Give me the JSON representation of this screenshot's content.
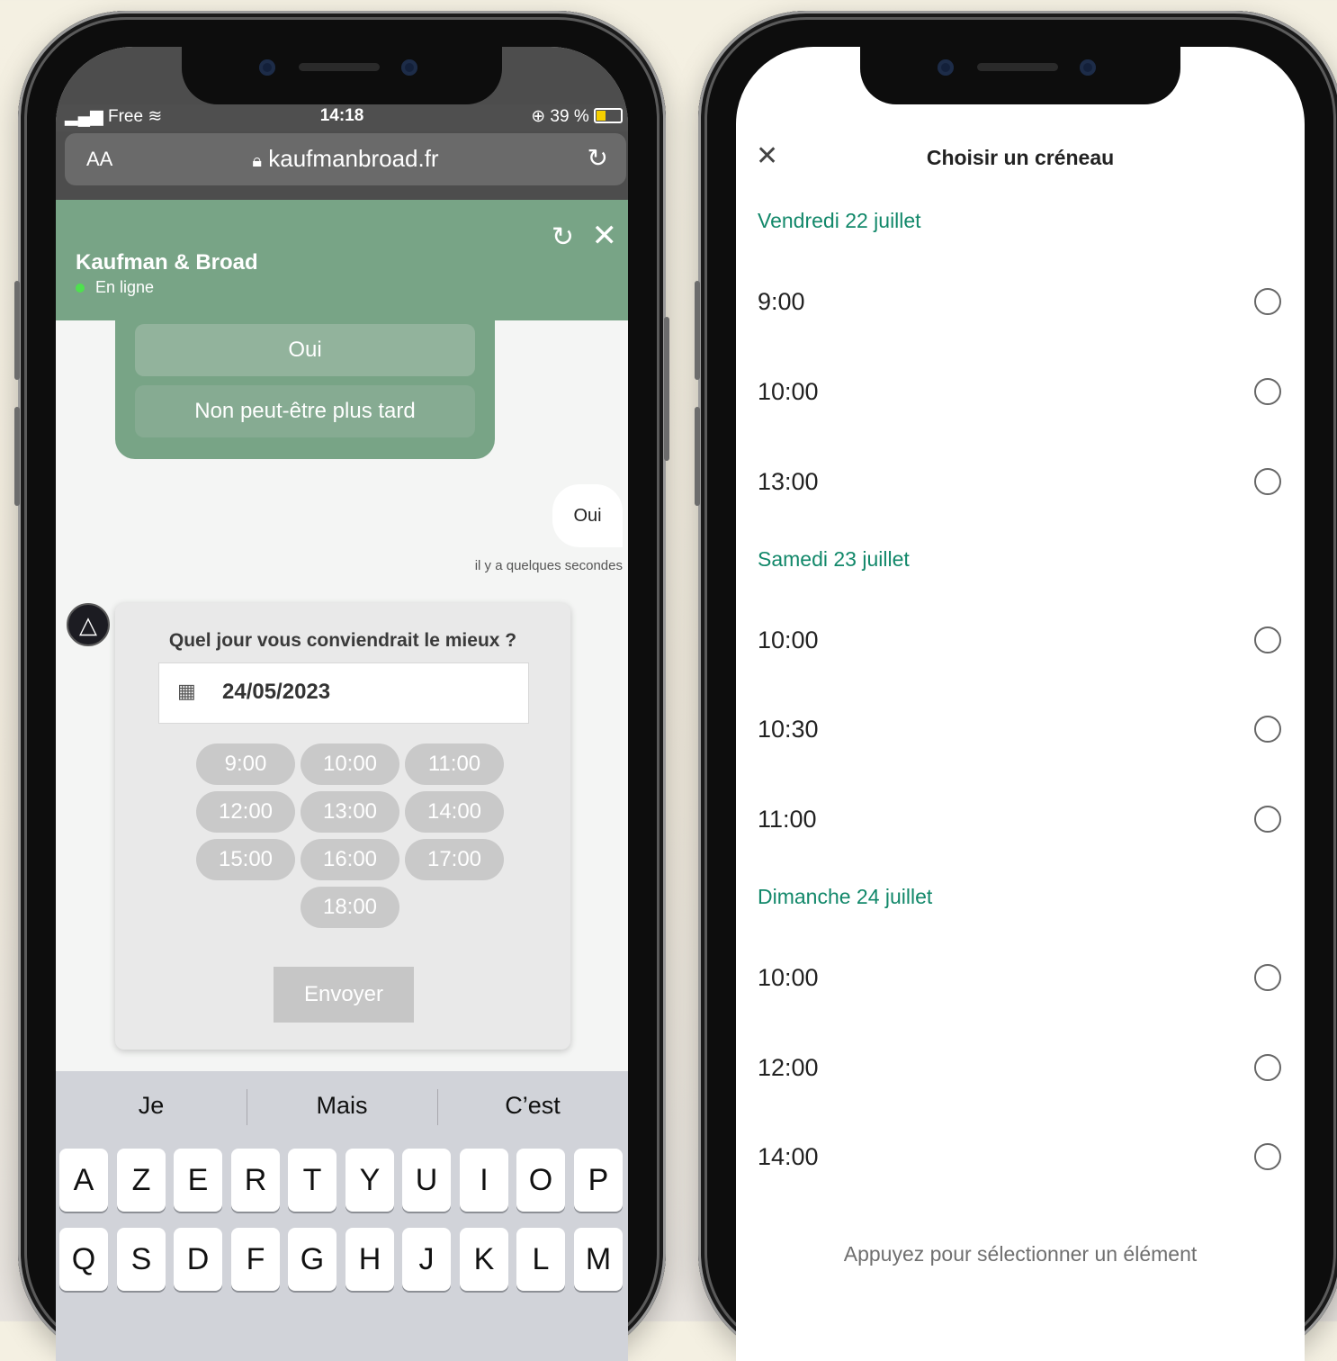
{
  "left": {
    "status": {
      "carrier": "Free",
      "time": "14:18",
      "battery": "39 %"
    },
    "browser": {
      "aa": "AA",
      "url": "kaufmanbroad.fr"
    },
    "chat": {
      "name": "Kaufman & Broad",
      "status": "En ligne",
      "choices": [
        "Oui",
        "Non peut-être plus tard"
      ],
      "user_msg": "Oui",
      "user_msg_time": "il y a quelques secondes",
      "card": {
        "question": "Quel jour vous conviendrait le mieux ?",
        "date": "24/05/2023",
        "slots": [
          "9:00",
          "10:00",
          "11:00",
          "12:00",
          "13:00",
          "14:00",
          "15:00",
          "16:00",
          "17:00",
          "18:00"
        ],
        "send": "Envoyer"
      }
    },
    "keyboard": {
      "suggestions": [
        "Je",
        "Mais",
        "C’est"
      ],
      "row1": [
        "A",
        "Z",
        "E",
        "R",
        "T",
        "Y",
        "U",
        "I",
        "O",
        "P"
      ],
      "row2": [
        "Q",
        "S",
        "D",
        "F",
        "G",
        "H",
        "J",
        "K",
        "L",
        "M"
      ]
    }
  },
  "right": {
    "title": "Choisir un créneau",
    "days": [
      {
        "label": "Vendredi 22 juillet",
        "times": [
          "9:00",
          "10:00",
          "13:00"
        ]
      },
      {
        "label": "Samedi 23 juillet",
        "times": [
          "10:00",
          "10:30",
          "11:00"
        ]
      },
      {
        "label": "Dimanche 24 juillet",
        "times": [
          "10:00",
          "12:00",
          "14:00"
        ]
      }
    ],
    "footer": "Appuyez pour sélectionner un élément"
  },
  "colors": {
    "brand_green": "#78a486",
    "day_green": "#12886a",
    "slot_gray": "#c9c9c9"
  }
}
